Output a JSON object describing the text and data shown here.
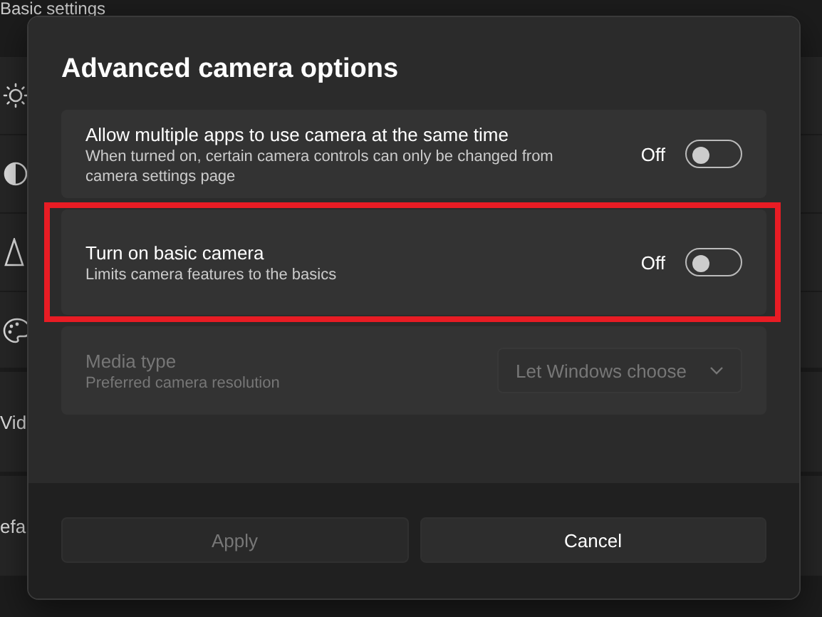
{
  "background": {
    "heading": "Basic settings",
    "rows": [
      {
        "label": "Vid"
      },
      {
        "label": "efa"
      }
    ]
  },
  "dialog": {
    "title": "Advanced camera options",
    "settings": [
      {
        "kind": "toggle",
        "title": "Allow multiple apps to use camera at the same time",
        "description": "When turned on, certain camera controls can only be changed from camera settings page",
        "state_label": "Off",
        "on": false,
        "highlighted": false,
        "disabled": false
      },
      {
        "kind": "toggle",
        "title": "Turn on basic camera",
        "description": "Limits camera features to the basics",
        "state_label": "Off",
        "on": false,
        "highlighted": true,
        "disabled": false
      },
      {
        "kind": "dropdown",
        "title": "Media type",
        "description": "Preferred camera resolution",
        "value": "Let Windows choose",
        "highlighted": false,
        "disabled": true
      }
    ],
    "buttons": [
      {
        "label": "Apply",
        "disabled": true
      },
      {
        "label": "Cancel",
        "disabled": false
      }
    ]
  }
}
